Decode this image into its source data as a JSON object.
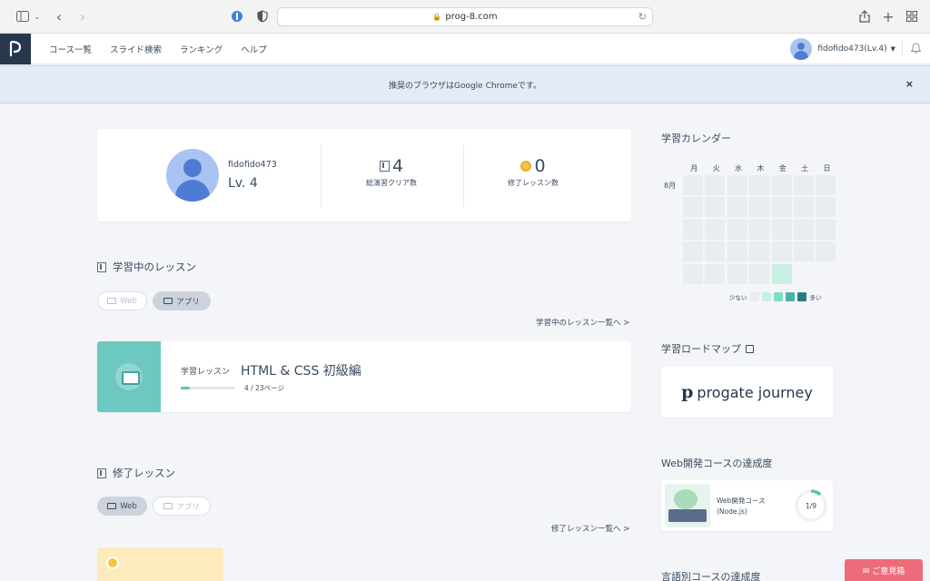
{
  "browser": {
    "url": "prog-8.com"
  },
  "header": {
    "nav": [
      "コース一覧",
      "スライド検索",
      "ランキング",
      "ヘルプ"
    ],
    "user_label": "fidofido473(Lv.4)"
  },
  "banner": {
    "text": "推奨のブラウザはGoogle Chromeです。",
    "close": "×"
  },
  "profile": {
    "username": "fidofido473",
    "level": "Lv. 4",
    "practice_clears": "4",
    "practice_clears_label": "総演習クリア数",
    "completed_lessons": "0",
    "completed_lessons_label": "修了レッスン数"
  },
  "learning": {
    "title": "学習中のレッスン",
    "tabs": [
      {
        "label": "Web",
        "active": false
      },
      {
        "label": "アプリ",
        "active": true
      }
    ],
    "more_link": "学習中のレッスン一覧へ >",
    "lesson": {
      "kind": "学習レッスン",
      "title": "HTML & CSS 初級編",
      "progress_text": "4 / 23ページ",
      "progress": 0.17
    }
  },
  "completed": {
    "title": "修了レッスン",
    "tabs": [
      {
        "label": "Web",
        "active": true
      },
      {
        "label": "アプリ",
        "active": false
      }
    ],
    "more_link": "修了レッスン一覧へ >"
  },
  "calendar": {
    "title": "学習カレンダー",
    "days": [
      "月",
      "火",
      "水",
      "木",
      "金",
      "土",
      "日"
    ],
    "month": "8月",
    "active_cells": [
      [
        4,
        4
      ]
    ],
    "legend_low": "少ない",
    "legend_high": "多い",
    "colors": [
      "#e9ecf1",
      "#c8f0e2",
      "#7fdcc6",
      "#4bb1a6",
      "#2a7a82"
    ]
  },
  "roadmap": {
    "title": "学習ロードマップ",
    "logo_text": "progate journey"
  },
  "web_course": {
    "title": "Web開発コースの達成度",
    "name": "Web開発コース (Node.js)",
    "progress": "1/9",
    "fraction": 0.111
  },
  "lang_course": {
    "title": "言語別コースの達成度"
  },
  "feedback": {
    "label": "✉ ご意見箱"
  }
}
